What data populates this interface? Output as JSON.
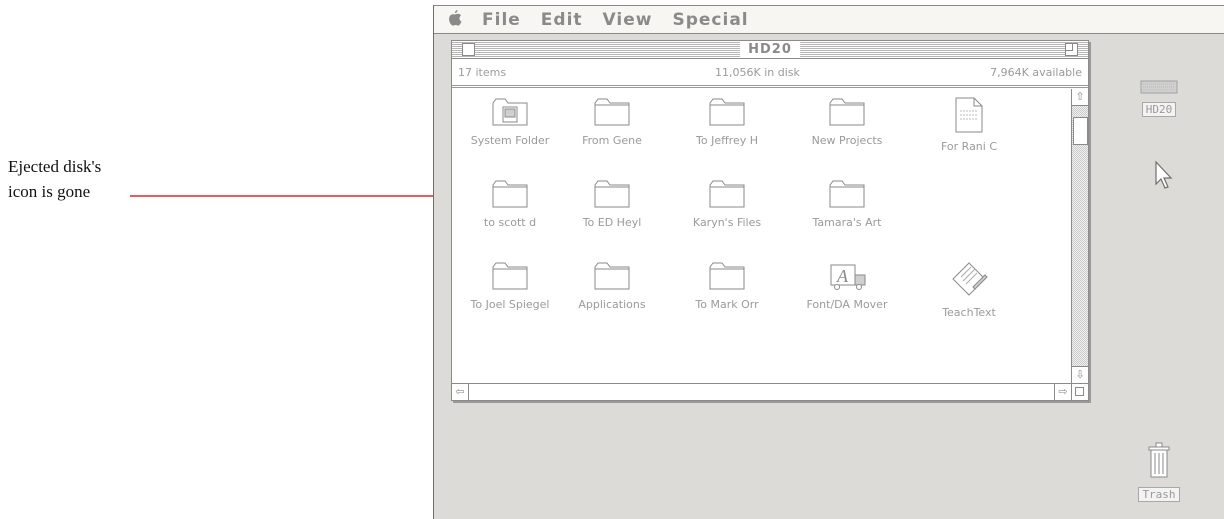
{
  "annotation": {
    "line1": "Ejected disk's",
    "line2": "icon is gone",
    "line_color": "#e0282a"
  },
  "menubar": {
    "apple": "",
    "menus": [
      "File",
      "Edit",
      "View",
      "Special"
    ]
  },
  "window": {
    "title": "HD20",
    "items_count": "17 items",
    "in_disk": "11,056K in disk",
    "available": "7,964K available",
    "files": [
      {
        "name": "System Folder",
        "icon": "system-folder-icon"
      },
      {
        "name": "From Gene",
        "icon": "folder-icon"
      },
      {
        "name": "To Jeffrey H",
        "icon": "folder-icon"
      },
      {
        "name": "New Projects",
        "icon": "folder-icon"
      },
      {
        "name": "For Rani C",
        "icon": "document-icon"
      },
      {
        "name": "to scott d",
        "icon": "folder-icon"
      },
      {
        "name": "To ED Heyl",
        "icon": "folder-icon"
      },
      {
        "name": "Karyn's Files",
        "icon": "folder-icon"
      },
      {
        "name": "Tamara's Art",
        "icon": "folder-icon"
      },
      {
        "name": "To Joel Spiegel",
        "icon": "folder-icon"
      },
      {
        "name": "Applications",
        "icon": "folder-icon"
      },
      {
        "name": "To Mark Orr",
        "icon": "folder-icon"
      },
      {
        "name": "Font/DA Mover",
        "icon": "font-da-mover-icon"
      },
      {
        "name": "TeachText",
        "icon": "teachtext-icon"
      }
    ]
  },
  "desktop": {
    "disk_label": "HD20",
    "trash_label": "Trash"
  }
}
